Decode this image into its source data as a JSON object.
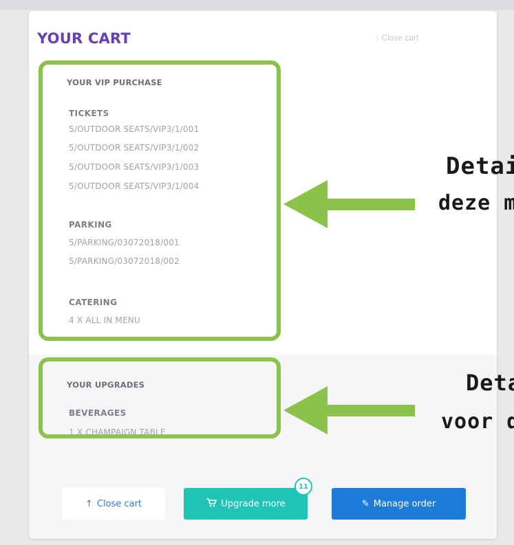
{
  "cart": {
    "title": "YOUR CART",
    "close_top_label": "Close cart",
    "close_top_icon": "up-arrow-icon"
  },
  "vip_purchase": {
    "heading": "YOUR VIP PURCHASE",
    "tickets": {
      "heading": "TICKETS",
      "items": [
        "5/OUTDOOR SEATS/VIP3/1/001",
        "5/OUTDOOR SEATS/VIP3/1/002",
        "5/OUTDOOR SEATS/VIP3/1/003",
        "5/OUTDOOR SEATS/VIP3/1/004"
      ]
    },
    "parking": {
      "heading": "PARKING",
      "items": [
        "5/PARKING/03072018/001",
        "5/PARKING/03072018/002"
      ]
    },
    "catering": {
      "heading": "CATERING",
      "items": [
        "4 X ALL IN MENU"
      ]
    }
  },
  "upgrades": {
    "heading": "YOUR UPGRADES",
    "beverages": {
      "heading": "BEVERAGES",
      "items": [
        "1 X CHAMPAIGN TABLE"
      ]
    }
  },
  "buttons": {
    "close_cart": "Close cart",
    "upgrade_more": "Upgrade more",
    "upgrade_badge": "11",
    "manage_order": "Manage order"
  },
  "annotations": {
    "first_line1": "Detail",
    "first_line2": "deze m",
    "second_line1": "Deta",
    "second_line2": "voor d"
  },
  "colors": {
    "title_purple": "#6a3fb5",
    "highlight_green": "#8bc34a",
    "teal_button": "#20c4b7",
    "blue_button": "#1e7bd8"
  }
}
